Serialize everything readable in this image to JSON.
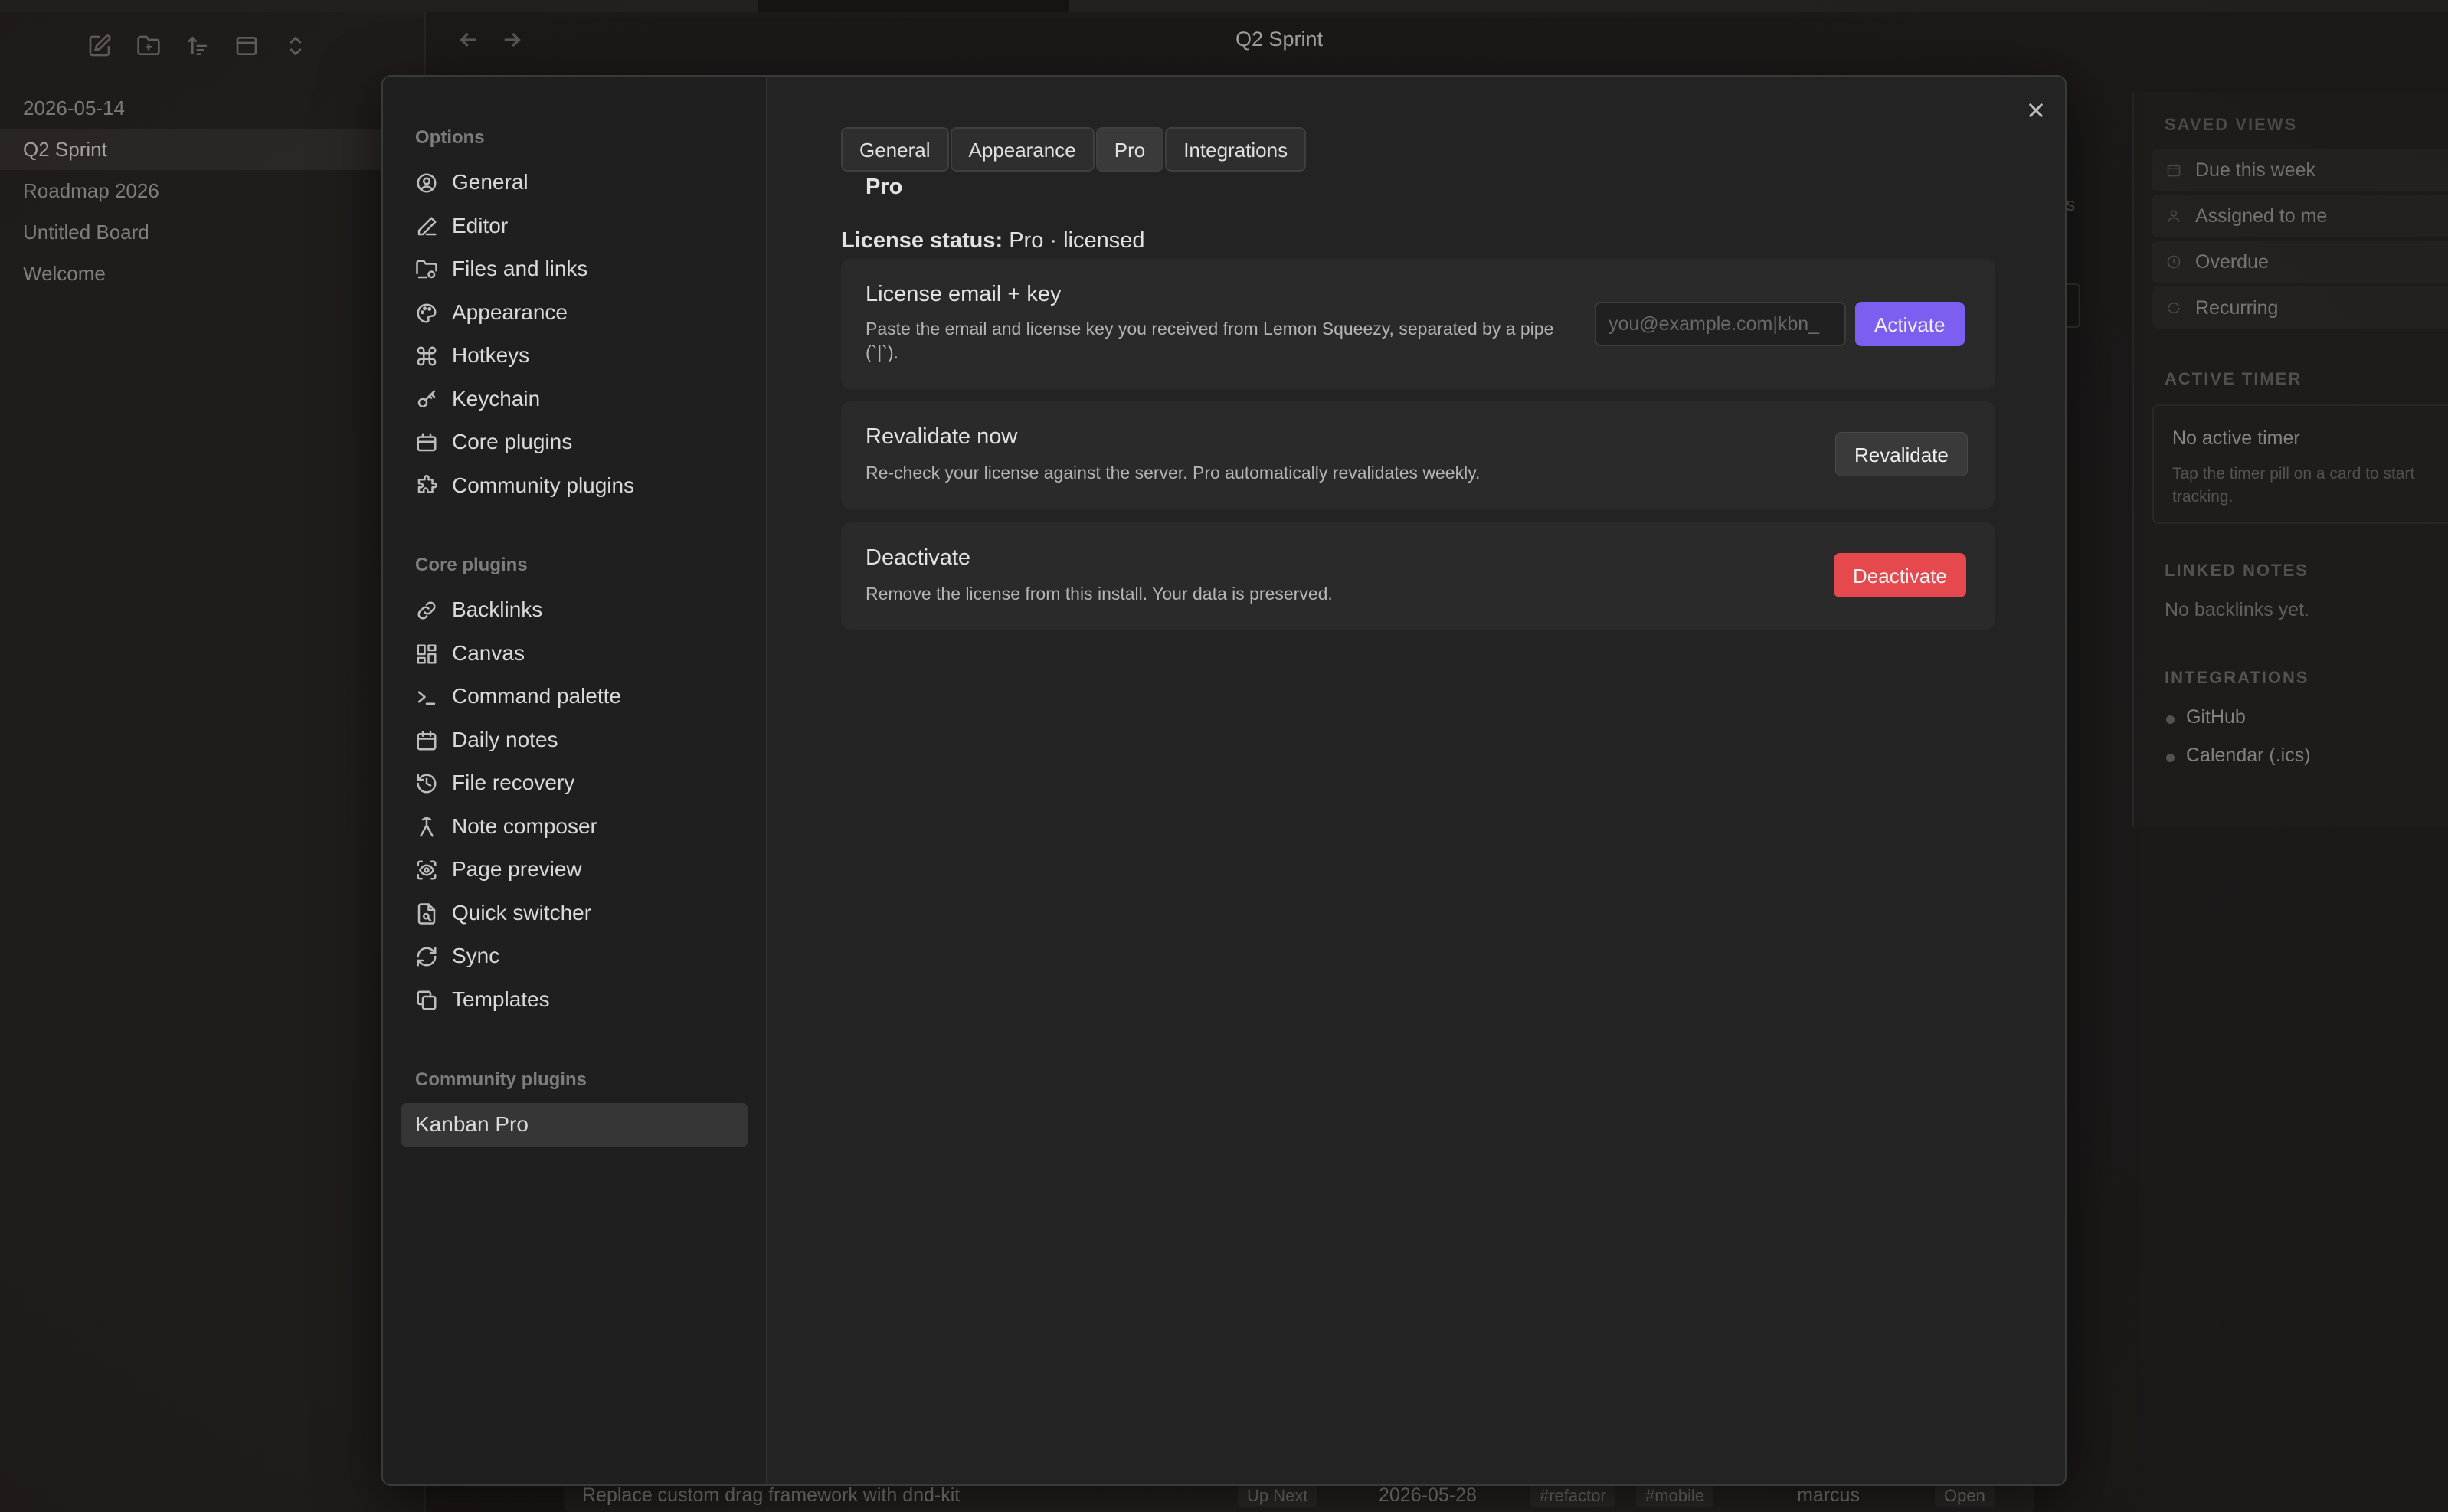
{
  "app": {
    "note_title": "Q2 Sprint",
    "files": [
      "2026-05-14",
      "Q2 Sprint",
      "Roadmap 2026",
      "Untitled Board",
      "Welcome"
    ],
    "active_file_index": 1
  },
  "background_row": {
    "title": "Replace custom drag framework with dnd-kit",
    "status": "Up Next",
    "due": "2026-05-28",
    "tags": [
      "#refactor",
      "#mobile"
    ],
    "assignee": "marcus",
    "state": "Open"
  },
  "background_partial": {
    "text": "es"
  },
  "right_panel": {
    "saved_views_heading": "SAVED VIEWS",
    "saved_views": [
      {
        "label": "Due this week",
        "icon": "calendar-icon"
      },
      {
        "label": "Assigned to me",
        "icon": "user-icon"
      },
      {
        "label": "Overdue",
        "icon": "clock-icon"
      },
      {
        "label": "Recurring",
        "icon": "repeat-icon"
      }
    ],
    "active_timer_heading": "ACTIVE TIMER",
    "timer_title": "No active timer",
    "timer_hint": "Tap the timer pill on a card to start tracking.",
    "linked_notes_heading": "LINKED NOTES",
    "linked_notes_empty": "No backlinks yet.",
    "integrations_heading": "INTEGRATIONS",
    "integrations": [
      "GitHub",
      "Calendar (.ics)"
    ]
  },
  "settings": {
    "options_heading": "Options",
    "options": [
      {
        "label": "General",
        "icon": "user-circle-icon"
      },
      {
        "label": "Editor",
        "icon": "pencil-icon"
      },
      {
        "label": "Files and links",
        "icon": "folder-icon"
      },
      {
        "label": "Appearance",
        "icon": "palette-icon"
      },
      {
        "label": "Hotkeys",
        "icon": "command-icon"
      },
      {
        "label": "Keychain",
        "icon": "key-icon"
      },
      {
        "label": "Core plugins",
        "icon": "plugin-box-icon"
      },
      {
        "label": "Community plugins",
        "icon": "puzzle-icon"
      }
    ],
    "core_plugins_heading": "Core plugins",
    "core_plugins": [
      {
        "label": "Backlinks",
        "icon": "link-icon"
      },
      {
        "label": "Canvas",
        "icon": "grid-icon"
      },
      {
        "label": "Command palette",
        "icon": "terminal-icon"
      },
      {
        "label": "Daily notes",
        "icon": "calendar-icon"
      },
      {
        "label": "File recovery",
        "icon": "history-icon"
      },
      {
        "label": "Note composer",
        "icon": "merge-icon"
      },
      {
        "label": "Page preview",
        "icon": "scan-eye-icon"
      },
      {
        "label": "Quick switcher",
        "icon": "file-search-icon"
      },
      {
        "label": "Sync",
        "icon": "refresh-icon"
      },
      {
        "label": "Templates",
        "icon": "copy-icon"
      }
    ],
    "community_plugins_heading": "Community plugins",
    "community_plugins": [
      {
        "label": "Kanban Pro"
      }
    ],
    "tabs": [
      "General",
      "Appearance",
      "Pro",
      "Integrations"
    ],
    "active_tab": "Pro",
    "section_title": "Pro",
    "license_status_label": "License status:",
    "license_status_value": "Pro · licensed",
    "license": {
      "name": "License email + key",
      "desc": "Paste the email and license key you received from Lemon Squeezy, separated by a pipe (`|`).",
      "placeholder": "you@example.com|kbn_",
      "value": "",
      "button": "Activate"
    },
    "revalidate": {
      "name": "Revalidate now",
      "desc": "Re-check your license against the server. Pro automatically revalidates weekly.",
      "button": "Revalidate"
    },
    "deactivate": {
      "name": "Deactivate",
      "desc": "Remove the license from this install. Your data is preserved.",
      "button": "Deactivate"
    }
  },
  "colors": {
    "accent": "#7c5ff0",
    "danger": "#e5484d",
    "modal_bg": "#232323"
  }
}
